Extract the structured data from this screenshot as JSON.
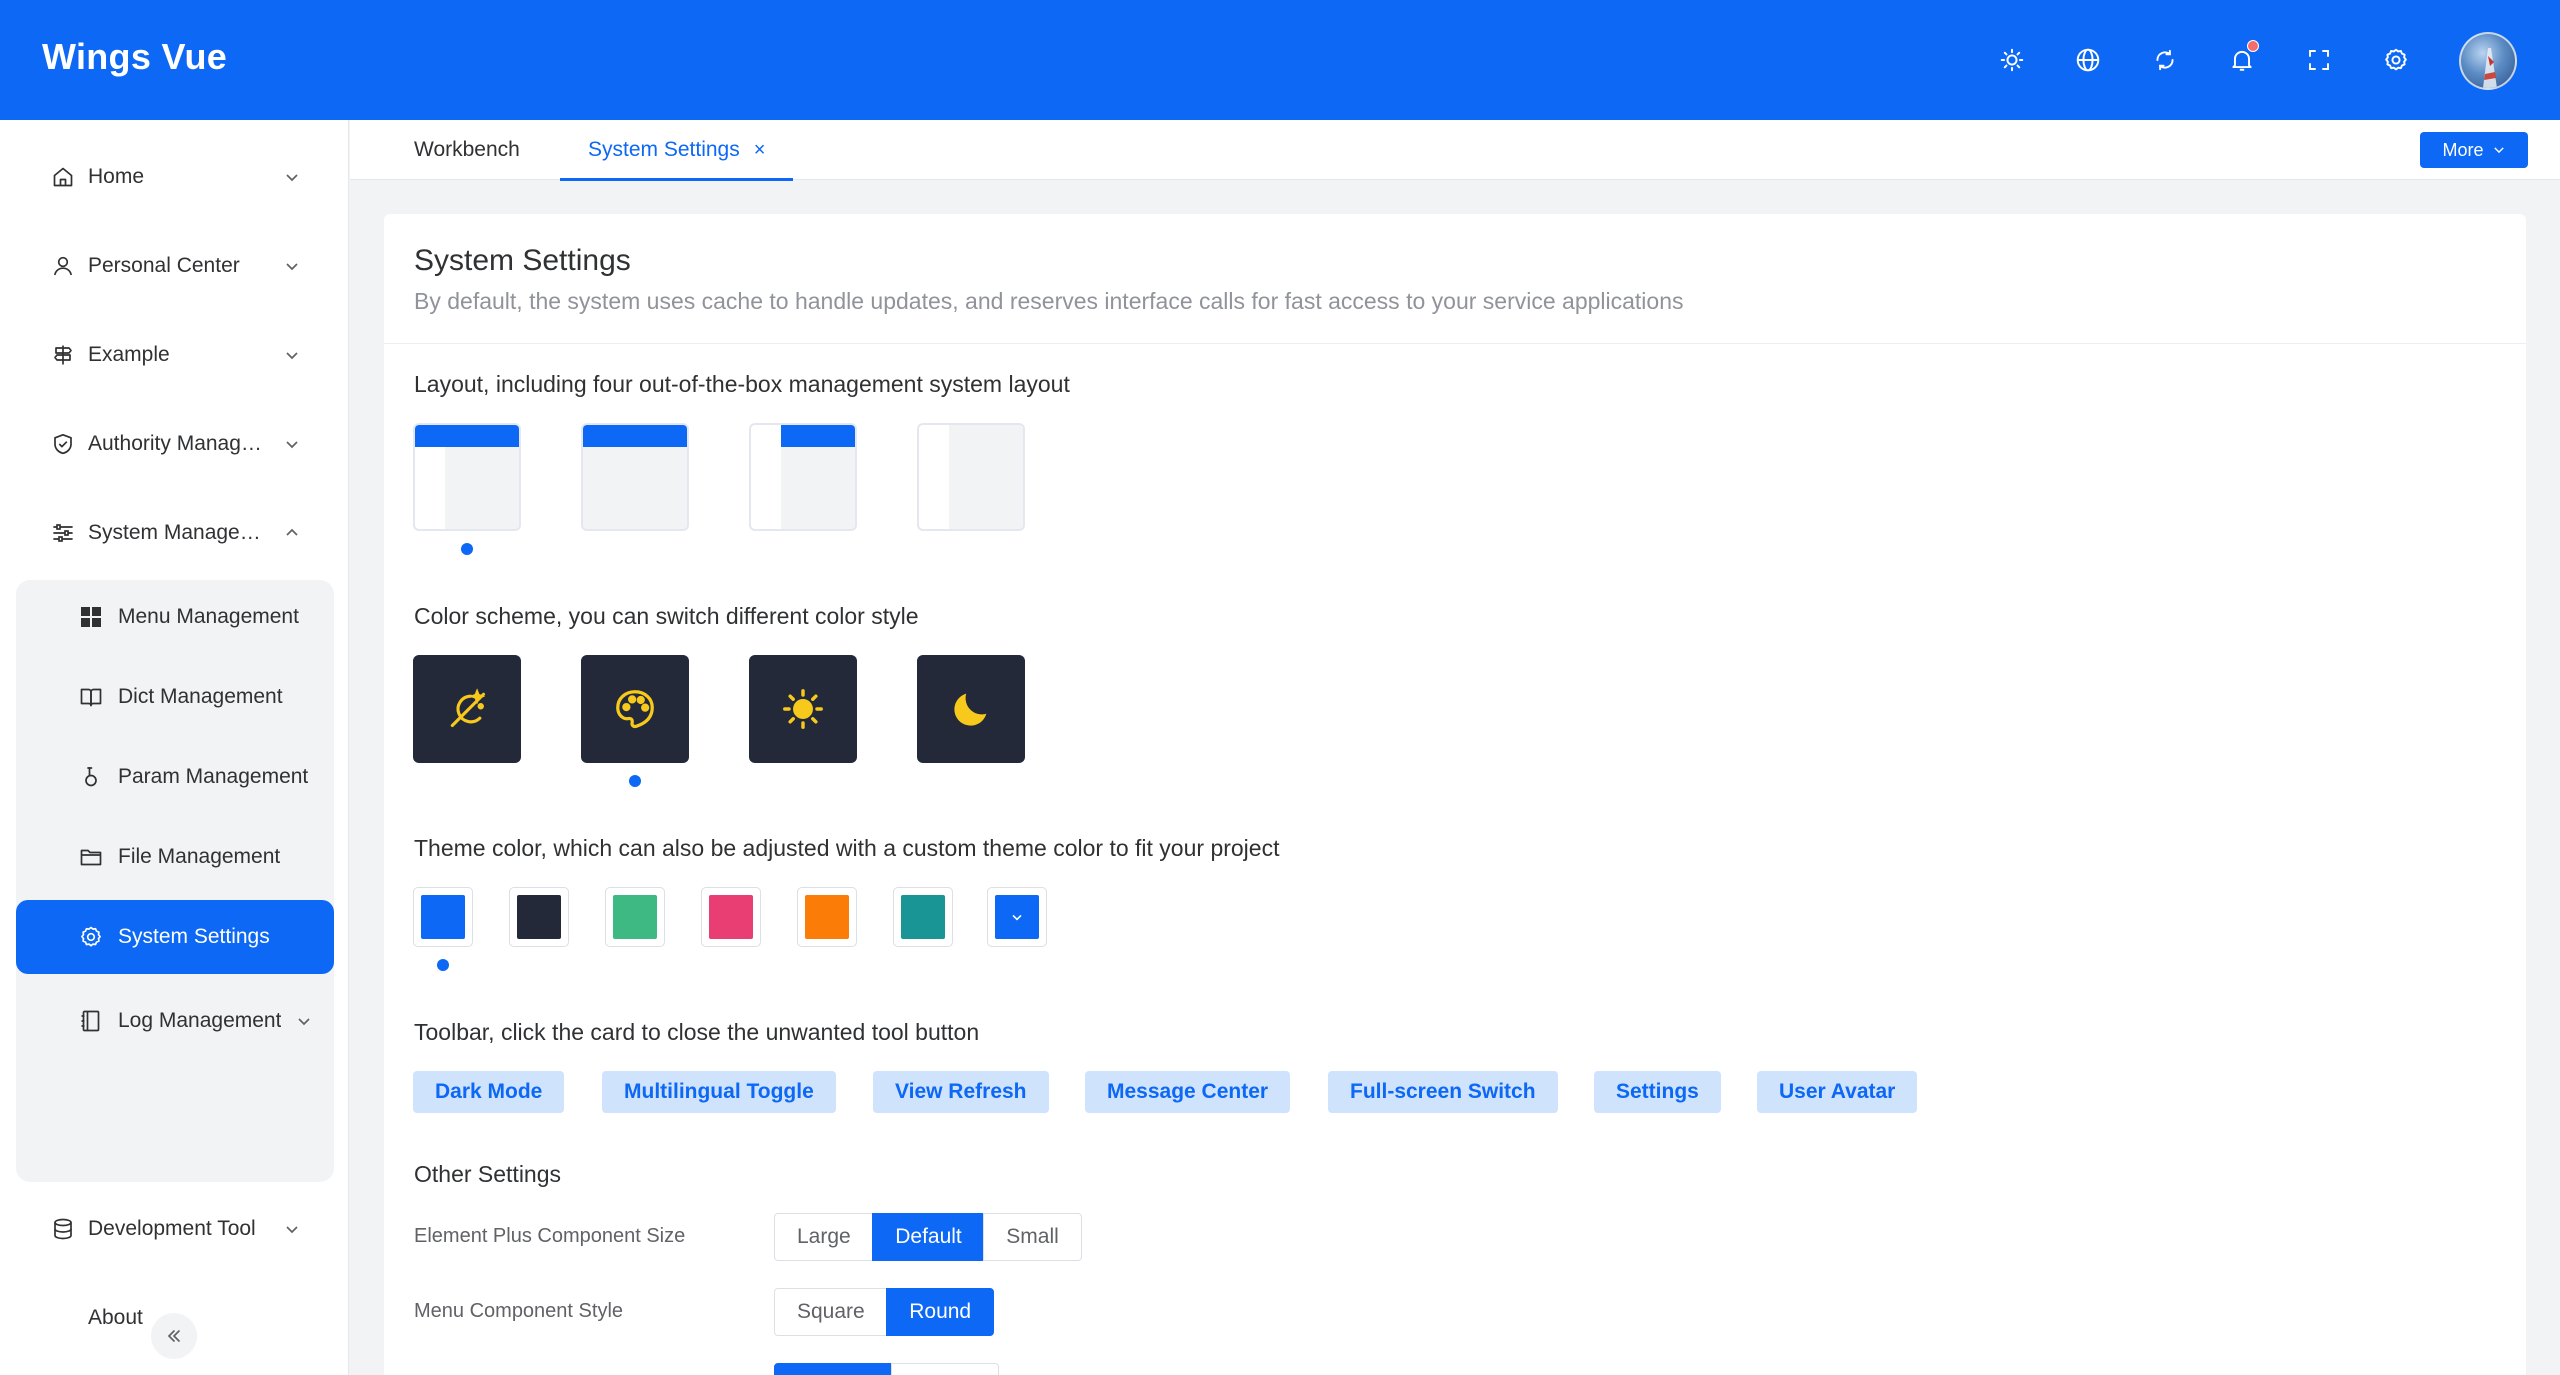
{
  "app": {
    "title": "Wings Vue"
  },
  "header_icons": [
    {
      "name": "dark-mode-icon"
    },
    {
      "name": "globe-icon"
    },
    {
      "name": "refresh-icon"
    },
    {
      "name": "bell-icon",
      "has_notification": true
    },
    {
      "name": "fullscreen-icon"
    },
    {
      "name": "settings-icon"
    }
  ],
  "sidebar": {
    "items": [
      {
        "label": "Home",
        "icon": "home-icon",
        "expandable": true
      },
      {
        "label": "Personal Center",
        "icon": "user-icon",
        "expandable": true
      },
      {
        "label": "Example",
        "icon": "signpost-icon",
        "expandable": true
      },
      {
        "label": "Authority Management",
        "icon": "shield-check-icon",
        "expandable": true
      },
      {
        "label": "System Management",
        "icon": "sliders-icon",
        "expanded": true
      },
      {
        "label": "Development Tool",
        "icon": "database-icon",
        "expandable": true
      },
      {
        "label": "About",
        "icon": "",
        "expandable": false
      }
    ],
    "sub_items": [
      {
        "label": "Menu Management",
        "icon": "grid-icon"
      },
      {
        "label": "Dict Management",
        "icon": "book-icon"
      },
      {
        "label": "Param Management",
        "icon": "param-icon"
      },
      {
        "label": "File Management",
        "icon": "folder-icon"
      },
      {
        "label": "System Settings",
        "icon": "gear-icon",
        "active": true
      },
      {
        "label": "Log Management",
        "icon": "notebook-icon",
        "expandable": true
      }
    ]
  },
  "tabs": [
    {
      "label": "Workbench",
      "active": false
    },
    {
      "label": "System Settings",
      "active": true,
      "close": "×"
    }
  ],
  "more_button": {
    "label": "More"
  },
  "page": {
    "title": "System Settings",
    "description": "By default, the system uses cache to handle updates, and reserves interface calls for fast access to your service applications"
  },
  "layout_section": {
    "title": "Layout, including four out-of-the-box management system layout",
    "options": [
      "side-header",
      "top-header",
      "mixed",
      "side"
    ],
    "selected_index": 0
  },
  "color_scheme_section": {
    "title": "Color scheme, you can switch different color style",
    "options": [
      "auto-icon",
      "palette-icon",
      "sun-icon",
      "moon-icon"
    ],
    "selected_index": 1
  },
  "theme_color_section": {
    "title": "Theme color, which can also be adjusted with a custom theme color to fit your project",
    "colors": [
      "#0c68f5",
      "#232939",
      "#3eb984",
      "#e83e74",
      "#fb7d08",
      "#1a9596"
    ],
    "custom_color": "#0c68f5",
    "selected_index": 0
  },
  "toolbar_section": {
    "title": "Toolbar, click the card to close the unwanted tool button",
    "tags": [
      "Dark Mode",
      "Multilingual Toggle",
      "View Refresh",
      "Message Center",
      "Full-screen Switch",
      "Settings",
      "User Avatar"
    ]
  },
  "other_settings": {
    "title": "Other Settings",
    "component_size": {
      "label": "Element Plus Component Size",
      "options": [
        "Large",
        "Default",
        "Small"
      ],
      "selected": "Default"
    },
    "menu_style": {
      "label": "Menu Component Style",
      "options": [
        "Square",
        "Round"
      ],
      "selected": "Round"
    }
  },
  "colors": {
    "primary": "#0c68f5",
    "dark": "#232939",
    "tag_bg": "#d0e3fd",
    "scheme_icon": "#f7c91c"
  }
}
